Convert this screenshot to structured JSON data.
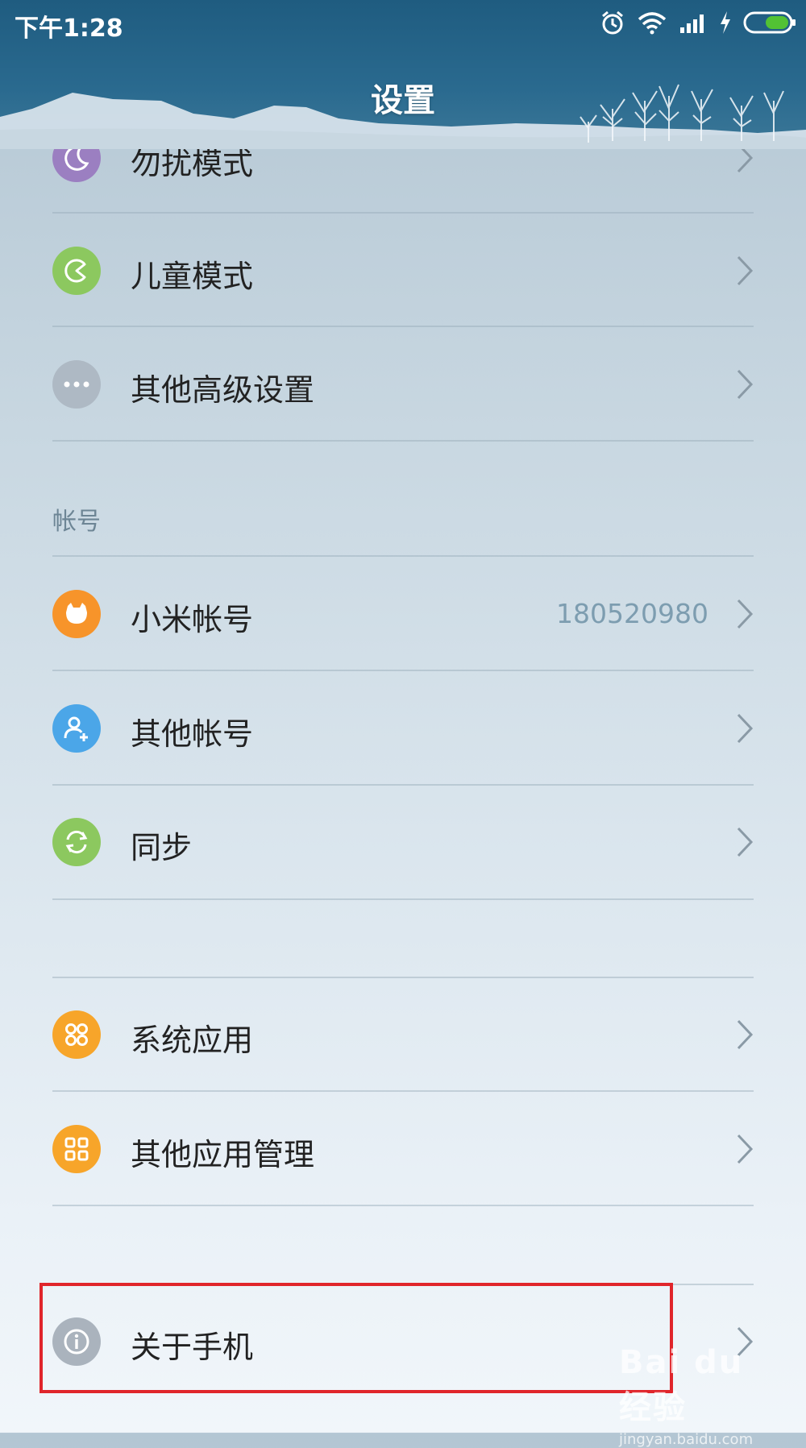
{
  "status_bar": {
    "time": "下午1:28",
    "icons": [
      "alarm-icon",
      "wifi-icon",
      "signal-icon",
      "charging-icon",
      "battery-icon"
    ]
  },
  "header": {
    "title": "设置"
  },
  "items": [
    {
      "id": "dnd",
      "label": "勿扰模式",
      "icon": "moon-icon",
      "color": "#9b7fc1"
    },
    {
      "id": "kids",
      "label": "儿童模式",
      "icon": "kids-mode-icon",
      "color": "#8cc85f"
    },
    {
      "id": "advanced",
      "label": "其他高级设置",
      "icon": "more-dots-icon",
      "color": "#aeb9c4"
    }
  ],
  "account_section": {
    "title": "帐号",
    "items": [
      {
        "id": "mi-account",
        "label": "小米帐号",
        "value": "180520980",
        "icon": "mi-bunny-icon",
        "color": "#f7942a"
      },
      {
        "id": "other-accounts",
        "label": "其他帐号",
        "icon": "add-user-icon",
        "color": "#4ba6e8"
      },
      {
        "id": "sync",
        "label": "同步",
        "icon": "sync-icon",
        "color": "#8cc85f"
      }
    ]
  },
  "apps_section": {
    "items": [
      {
        "id": "system-apps",
        "label": "系统应用",
        "icon": "system-apps-icon",
        "color": "#f7a52a"
      },
      {
        "id": "app-management",
        "label": "其他应用管理",
        "icon": "app-grid-icon",
        "color": "#f7a52a"
      }
    ]
  },
  "about": {
    "label": "关于手机",
    "icon": "info-icon",
    "color": "#aab3bd"
  },
  "watermark": {
    "brand": "Bai du 经验",
    "url": "jingyan.baidu.com"
  },
  "colors": {
    "highlight": "#e0252b",
    "header": "#2a6a8f"
  }
}
